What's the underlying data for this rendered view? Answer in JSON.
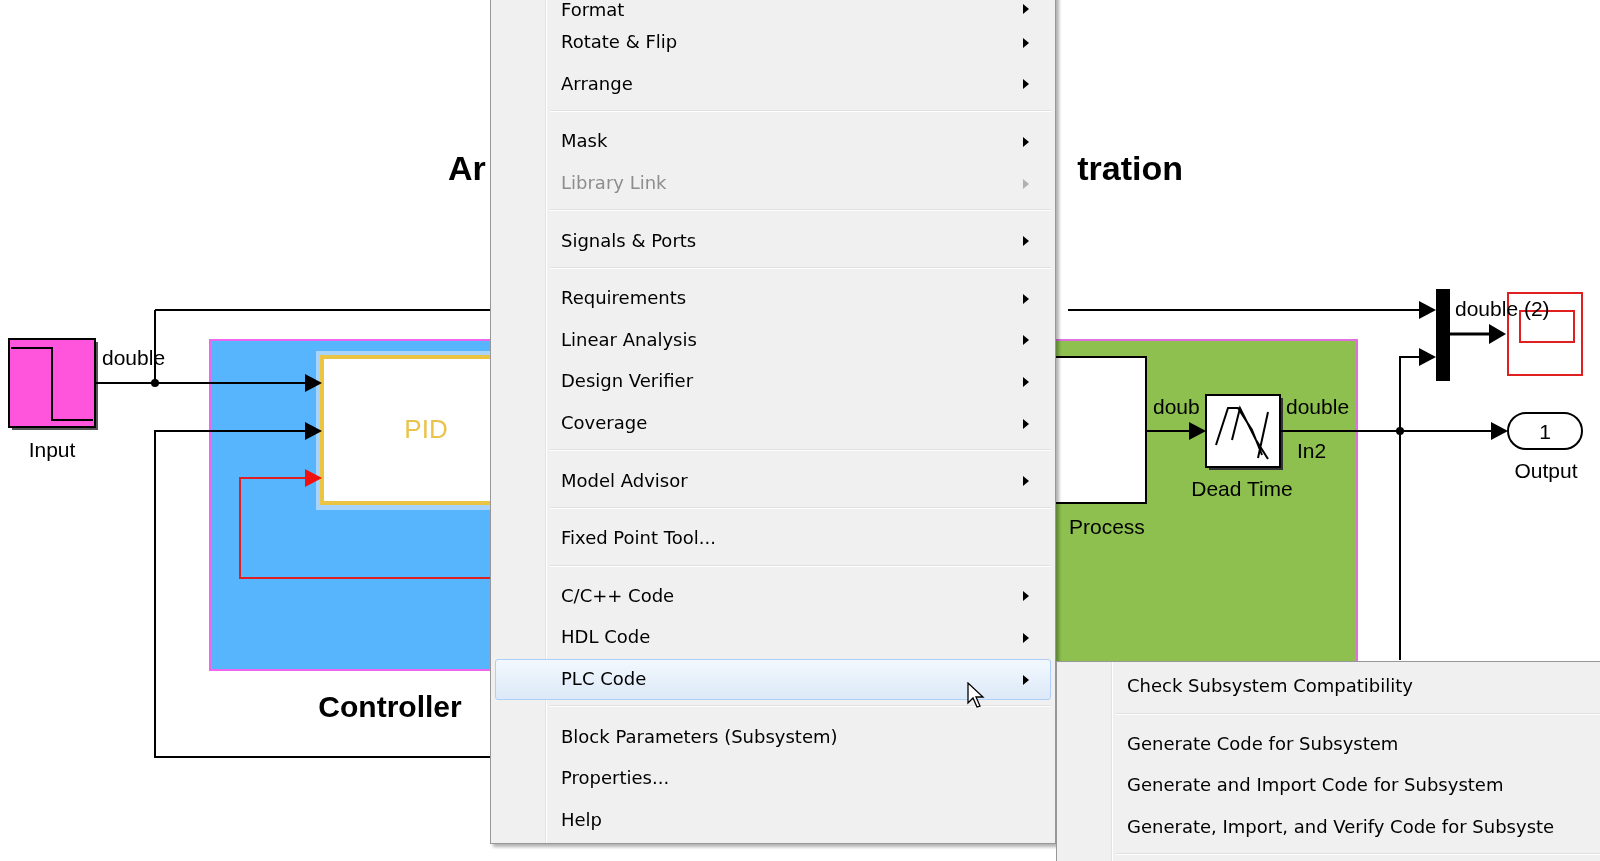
{
  "diagram": {
    "title_fragments": [
      "Ar",
      "tration"
    ],
    "input": {
      "label": "Input",
      "signal": "double"
    },
    "controller": {
      "label": "Controller",
      "block": "PID"
    },
    "plant": {
      "process_label": "Process",
      "dead_time_label": "Dead Time",
      "in_signal": "doub",
      "out_signal": "double",
      "out_port": "In2"
    },
    "mux": {
      "signal": "double (2)"
    },
    "output": {
      "label": "Output",
      "port": "1"
    }
  },
  "context_menu": {
    "items": [
      {
        "label": "Format",
        "submenu": true,
        "disabled": false,
        "selected": false,
        "separator_after": false
      },
      {
        "label": "Rotate & Flip",
        "submenu": true,
        "disabled": false,
        "selected": false,
        "separator_after": false
      },
      {
        "label": "Arrange",
        "submenu": true,
        "disabled": false,
        "selected": false,
        "separator_after": true
      },
      {
        "label": "Mask",
        "submenu": true,
        "disabled": false,
        "selected": false,
        "separator_after": false
      },
      {
        "label": "Library Link",
        "submenu": true,
        "disabled": true,
        "selected": false,
        "separator_after": true
      },
      {
        "label": "Signals & Ports",
        "submenu": true,
        "disabled": false,
        "selected": false,
        "separator_after": true
      },
      {
        "label": "Requirements",
        "submenu": true,
        "disabled": false,
        "selected": false,
        "separator_after": false
      },
      {
        "label": "Linear Analysis",
        "submenu": true,
        "disabled": false,
        "selected": false,
        "separator_after": false
      },
      {
        "label": "Design Verifier",
        "submenu": true,
        "disabled": false,
        "selected": false,
        "separator_after": false
      },
      {
        "label": "Coverage",
        "submenu": true,
        "disabled": false,
        "selected": false,
        "separator_after": true
      },
      {
        "label": "Model Advisor",
        "submenu": true,
        "disabled": false,
        "selected": false,
        "separator_after": true
      },
      {
        "label": "Fixed Point Tool...",
        "submenu": false,
        "disabled": false,
        "selected": false,
        "separator_after": true
      },
      {
        "label": "C/C++ Code",
        "submenu": true,
        "disabled": false,
        "selected": false,
        "separator_after": false
      },
      {
        "label": "HDL Code",
        "submenu": true,
        "disabled": false,
        "selected": false,
        "separator_after": false
      },
      {
        "label": "PLC Code",
        "submenu": true,
        "disabled": false,
        "selected": true,
        "separator_after": true
      },
      {
        "label": "Block Parameters (Subsystem)",
        "submenu": false,
        "disabled": false,
        "selected": false,
        "separator_after": false
      },
      {
        "label": "Properties...",
        "submenu": false,
        "disabled": false,
        "selected": false,
        "separator_after": false
      },
      {
        "label": "Help",
        "submenu": false,
        "disabled": false,
        "selected": false,
        "separator_after": false
      }
    ]
  },
  "submenu": {
    "items": [
      {
        "label": "Check Subsystem Compatibility",
        "selected": false,
        "separator_after": true
      },
      {
        "label": "Generate Code for Subsystem",
        "selected": false,
        "separator_after": false
      },
      {
        "label": "Generate and Import Code for Subsystem",
        "selected": false,
        "separator_after": false
      },
      {
        "label": "Generate, Import, and Verify Code for Subsyste",
        "selected": false,
        "separator_after": true
      }
    ]
  }
}
